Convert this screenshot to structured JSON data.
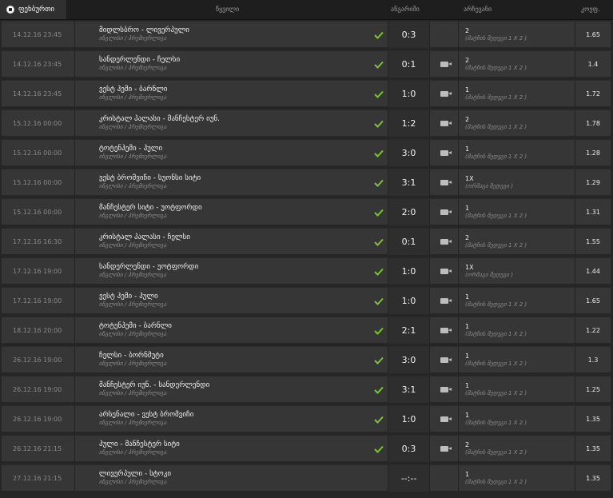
{
  "header": {
    "tab": "ფეხბურთი",
    "col_match": "წყვილი",
    "col_score": "ანგარიში",
    "col_bet": "არჩევანი",
    "col_coef": "კოეფ."
  },
  "colors": {
    "check": "#7bc23a",
    "row": "#363636",
    "background": "#262626"
  },
  "rows": [
    {
      "date": "14.12.16 23:45",
      "teams": "მიდლსბრო - ლივერპული",
      "league": "ინგლისი / პრემიერლიგა",
      "score": "0:3",
      "video": false,
      "pick": "2",
      "type": "(მატჩის შედეგი 1 X 2 )",
      "coef": "1.65",
      "won": true
    },
    {
      "date": "14.12.16 23:45",
      "teams": "სანდერლენდი - ჩელსი",
      "league": "ინგლისი / პრემიერლიგა",
      "score": "0:1",
      "video": true,
      "pick": "2",
      "type": "(მატჩის შედეგი 1 X 2 )",
      "coef": "1.4",
      "won": true
    },
    {
      "date": "14.12.16 23:45",
      "teams": "ვესტ ჰემი - ბარნლი",
      "league": "ინგლისი / პრემიერლიგა",
      "score": "1:0",
      "video": true,
      "pick": "1",
      "type": "(მატჩის შედეგი 1 X 2 )",
      "coef": "1.72",
      "won": true
    },
    {
      "date": "15.12.16 00:00",
      "teams": "კრისტალ პალასი - მანჩესტერ იუნ.",
      "league": "ინგლისი / პრემიერლიგა",
      "score": "1:2",
      "video": true,
      "pick": "2",
      "type": "(მატჩის შედეგი 1 X 2 )",
      "coef": "1.78",
      "won": true
    },
    {
      "date": "15.12.16 00:00",
      "teams": "ტოტენჰემი - ჰული",
      "league": "ინგლისი / პრემიერლიგა",
      "score": "3:0",
      "video": true,
      "pick": "1",
      "type": "(მატჩის შედეგი 1 X 2 )",
      "coef": "1.28",
      "won": true
    },
    {
      "date": "15.12.16 00:00",
      "teams": "ვესტ ბრომვიჩი - სუონსი სიტი",
      "league": "ინგლისი / პრემიერლიგა",
      "score": "3:1",
      "video": true,
      "pick": "1X",
      "type": "(ორმაგი შედეგი )",
      "coef": "1.29",
      "won": true
    },
    {
      "date": "15.12.16 00:00",
      "teams": "მანჩესტერ სიტი - უოტფორდი",
      "league": "ინგლისი / პრემიერლიგა",
      "score": "2:0",
      "video": true,
      "pick": "1",
      "type": "(მატჩის შედეგი 1 X 2 )",
      "coef": "1.31",
      "won": true
    },
    {
      "date": "17.12.16 16:30",
      "teams": "კრისტალ პალასი - ჩელსი",
      "league": "ინგლისი / პრემიერლიგა",
      "score": "0:1",
      "video": true,
      "pick": "2",
      "type": "(მატჩის შედეგი 1 X 2 )",
      "coef": "1.55",
      "won": true
    },
    {
      "date": "17.12.16 19:00",
      "teams": "სანდერლენდი - უოტფორდი",
      "league": "ინგლისი / პრემიერლიგა",
      "score": "1:0",
      "video": true,
      "pick": "1X",
      "type": "(ორმაგი შედეგი )",
      "coef": "1.44",
      "won": true
    },
    {
      "date": "17.12.16 19:00",
      "teams": "ვესტ ჰემი - ჰული",
      "league": "ინგლისი / პრემიერლიგა",
      "score": "1:0",
      "video": true,
      "pick": "1",
      "type": "(მატჩის შედეგი 1 X 2 )",
      "coef": "1.65",
      "won": true
    },
    {
      "date": "18.12.16 20:00",
      "teams": "ტოტენჰემი - ბარნლი",
      "league": "ინგლისი / პრემიერლიგა",
      "score": "2:1",
      "video": true,
      "pick": "1",
      "type": "(მატჩის შედეგი 1 X 2 )",
      "coef": "1.22",
      "won": true
    },
    {
      "date": "26.12.16 19:00",
      "teams": "ჩელსი - ბორნმუტი",
      "league": "ინგლისი / პრემიერლიგა",
      "score": "3:0",
      "video": true,
      "pick": "1",
      "type": "(მატჩის შედეგი 1 X 2 )",
      "coef": "1.3",
      "won": true
    },
    {
      "date": "26.12.16 19:00",
      "teams": "მანჩესტერ იუნ. - სანდერლენდი",
      "league": "ინგლისი / პრემიერლიგა",
      "score": "3:1",
      "video": true,
      "pick": "1",
      "type": "(მატჩის შედეგი 1 X 2 )",
      "coef": "1.25",
      "won": true
    },
    {
      "date": "26.12.16 19:00",
      "teams": "არსენალი - ვესტ ბრომვიჩი",
      "league": "ინგლისი / პრემიერლიგა",
      "score": "1:0",
      "video": true,
      "pick": "1",
      "type": "(მატჩის შედეგი 1 X 2 )",
      "coef": "1.35",
      "won": true
    },
    {
      "date": "26.12.16 21:15",
      "teams": "ჰული - მანჩესტერ სიტი",
      "league": "ინგლისი / პრემიერლიგა",
      "score": "0:3",
      "video": true,
      "pick": "2",
      "type": "(მატჩის შედეგი 1 X 2 )",
      "coef": "1.35",
      "won": true
    },
    {
      "date": "27.12.16 21:15",
      "teams": "ლივერპული - სტოკი",
      "league": "ინგლისი / პრემიერლიგა",
      "score": "--:--",
      "video": false,
      "pick": "1",
      "type": "(მატჩის შედეგი 1 X 2 )",
      "coef": "1.35",
      "won": false
    }
  ]
}
